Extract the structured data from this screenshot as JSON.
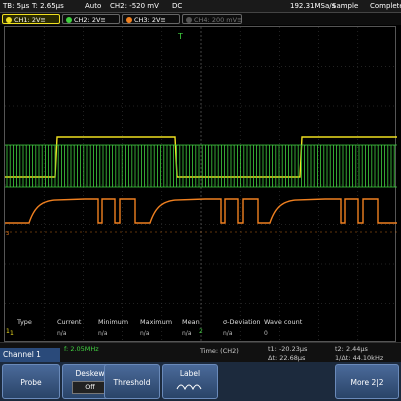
{
  "topbar": {
    "tb": "TB: 5µs",
    "t": "T: 2.65µs",
    "mode": "Auto",
    "trigger": "CH2: -520 mV",
    "trigger_coupling": "DC",
    "rate": "192.31MSa/s",
    "rate_mode": "Sample",
    "status": "Complete"
  },
  "channels": [
    {
      "label": "CH1: 2V≡",
      "color": "#f0e020",
      "active": true
    },
    {
      "label": "CH2: 2V≡",
      "color": "#40d040",
      "active": false
    },
    {
      "label": "CH3: 2V≡",
      "color": "#f08020",
      "active": false
    },
    {
      "label": "CH4: 200 mV≡",
      "color": "#555555",
      "active": false
    }
  ],
  "markers": {
    "trigger_t": "T",
    "ch1": "1",
    "ch3": "3",
    "ch2": "2"
  },
  "measurements": {
    "headers": [
      "Type",
      "Current",
      "Minimum",
      "Maximum",
      "Mean",
      "σ-Deviation",
      "Wave count"
    ],
    "row_index": "1",
    "row": [
      "",
      "n/a",
      "n/a",
      "n/a",
      "n/a",
      "n/a",
      "0"
    ]
  },
  "info": {
    "freq": "f: 2.05MHz",
    "time_label": "Time: (CH2)",
    "t1": "t1: -20.23µs",
    "t2": "t2: 2.44µs",
    "dt": "Δt: 22.68µs",
    "inv_dt": "1/Δt: 44.10kHz"
  },
  "channel_menu": "Channel 1",
  "softkeys": [
    {
      "label": "Probe"
    },
    {
      "label": "Deskew",
      "value": "Off"
    },
    {
      "label": "Threshold"
    },
    {
      "label": "Label"
    },
    {
      "label": "More 2|2"
    }
  ],
  "colors": {
    "ch1": "#f0e020",
    "ch2": "#40d040",
    "ch3": "#f08020",
    "grid": "#555555"
  }
}
